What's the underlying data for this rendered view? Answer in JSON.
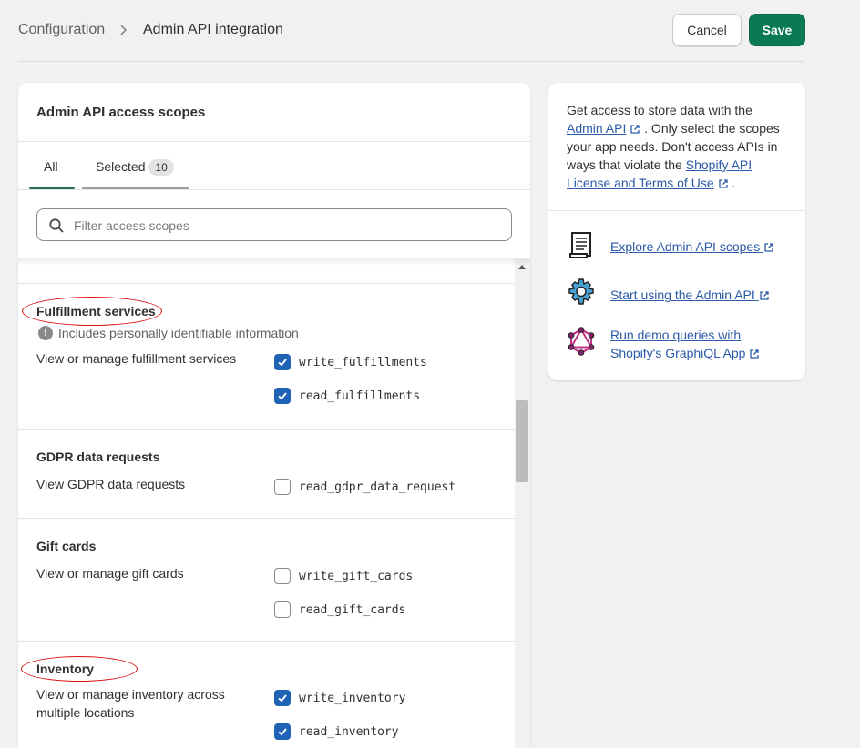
{
  "header": {
    "breadcrumb_root": "Configuration",
    "title": "Admin API integration",
    "cancel_label": "Cancel",
    "save_label": "Save"
  },
  "scopes_card": {
    "title": "Admin API access scopes",
    "tabs": [
      {
        "label": "All",
        "active": true
      },
      {
        "label": "Selected",
        "badge": "10",
        "active": false
      }
    ],
    "search": {
      "placeholder": "Filter access scopes",
      "value": ""
    },
    "sections": [
      {
        "title": "Fulfillment services",
        "pii_note": "Includes personally identifiable information",
        "description": "View or manage fulfillment services",
        "scopes": [
          {
            "name": "write_fulfillments",
            "checked": true
          },
          {
            "name": "read_fulfillments",
            "checked": true
          }
        ]
      },
      {
        "title": "GDPR data requests",
        "description": "View GDPR data requests",
        "scopes": [
          {
            "name": "read_gdpr_data_request",
            "checked": false
          }
        ]
      },
      {
        "title": "Gift cards",
        "description": "View or manage gift cards",
        "scopes": [
          {
            "name": "write_gift_cards",
            "checked": false
          },
          {
            "name": "read_gift_cards",
            "checked": false
          }
        ]
      },
      {
        "title": "Inventory",
        "description": "View or manage inventory across multiple locations",
        "scopes": [
          {
            "name": "write_inventory",
            "checked": true
          },
          {
            "name": "read_inventory",
            "checked": true
          }
        ]
      }
    ]
  },
  "info_card": {
    "text_1": "Get access to store data with the",
    "link_admin_api": "Admin API",
    "text_2": ". Only select the scopes your app needs. Don't access APIs in ways that violate the",
    "link_license": "Shopify API License and Terms of Use",
    "text_3": ".",
    "resources": [
      {
        "label": "Explore Admin API scopes",
        "icon": "scroll-icon"
      },
      {
        "label": "Start using the Admin API",
        "icon": "gear-icon"
      },
      {
        "label": "Run demo queries with Shopify's GraphiQL App",
        "icon": "graphql-icon"
      }
    ]
  },
  "colors": {
    "save_button": "#0a7a55",
    "checkbox_checked": "#1f62b6",
    "link": "#2a5aa8",
    "annotation_ellipse": "#dd1111"
  }
}
